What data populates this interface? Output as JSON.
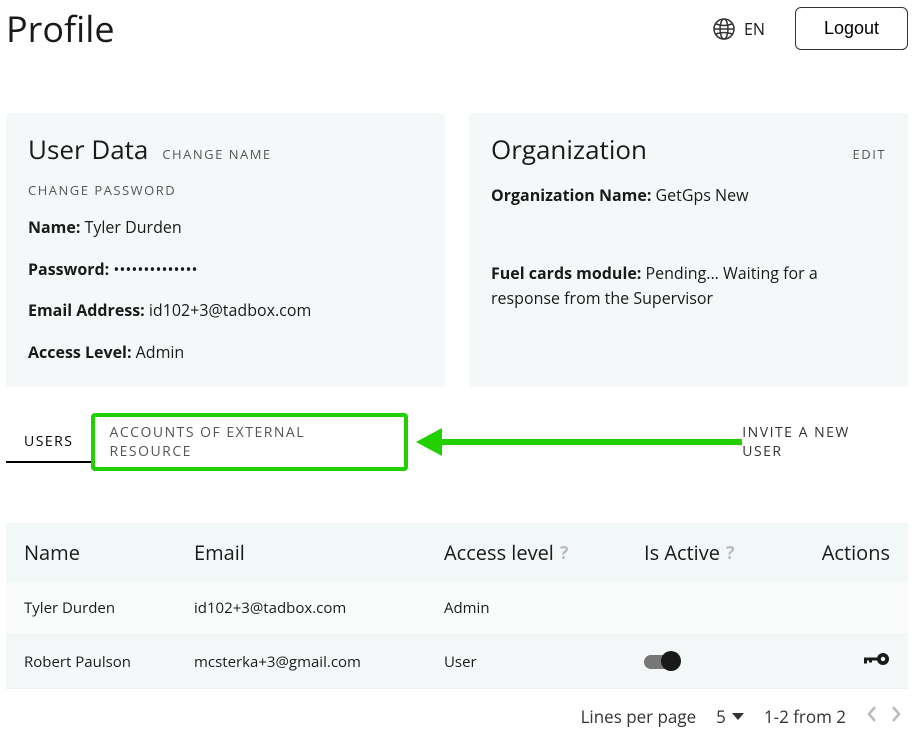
{
  "header": {
    "title": "Profile",
    "lang": "EN",
    "logout": "Logout"
  },
  "userData": {
    "title": "User Data",
    "changeName": "CHANGE NAME",
    "changePassword": "CHANGE PASSWORD",
    "nameLabel": "Name:",
    "nameValue": "Tyler Durden",
    "passwordLabel": "Password:",
    "passwordValue": "••••••••••••••",
    "emailLabel": "Email Address:",
    "emailValue": "id102+3@tadbox.com",
    "accessLabel": "Access Level:",
    "accessValue": "Admin"
  },
  "organization": {
    "title": "Organization",
    "edit": "EDIT",
    "nameLabel": "Organization Name:",
    "nameValue": "GetGps New",
    "fuelLabel": "Fuel cards module:",
    "fuelValue": "Pending... Waiting for a response from the Supervisor"
  },
  "tabs": {
    "users": "USERS",
    "accounts": "ACCOUNTS OF EXTERNAL RESOURCE",
    "invite": "INVITE A NEW USER"
  },
  "table": {
    "headers": {
      "name": "Name",
      "email": "Email",
      "access": "Access level",
      "active": "Is Active",
      "actions": "Actions"
    },
    "rows": [
      {
        "name": "Tyler Durden",
        "email": "id102+3@tadbox.com",
        "access": "Admin",
        "toggle": false,
        "key": false
      },
      {
        "name": "Robert Paulson",
        "email": "mcsterka+3@gmail.com",
        "access": "User",
        "toggle": true,
        "key": true
      }
    ]
  },
  "pager": {
    "lpp": "Lines per page",
    "lppValue": "5",
    "range": "1-2 from 2"
  }
}
